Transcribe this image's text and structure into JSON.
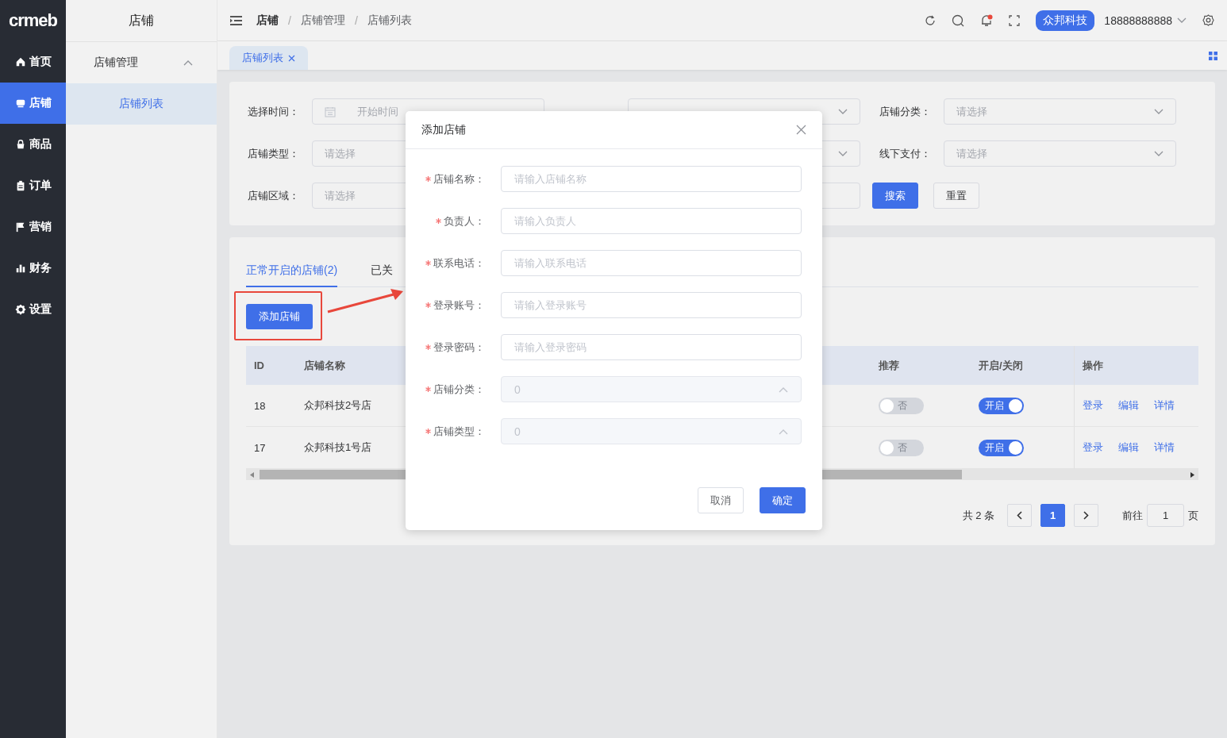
{
  "sidebar": {
    "logo": "crmeb",
    "items": [
      {
        "label": "首页",
        "selected": false
      },
      {
        "label": "店铺",
        "selected": true
      },
      {
        "label": "商品",
        "selected": false
      },
      {
        "label": "订单",
        "selected": false
      },
      {
        "label": "营销",
        "selected": false
      },
      {
        "label": "财务",
        "selected": false
      },
      {
        "label": "设置",
        "selected": false
      }
    ]
  },
  "submenu": {
    "title": "店铺",
    "groups": [
      {
        "label": "店铺管理",
        "expanded": true,
        "children": [
          {
            "label": "店铺列表",
            "selected": true
          }
        ]
      }
    ]
  },
  "header": {
    "breadcrumb": [
      "店铺",
      "店铺管理",
      "店铺列表"
    ],
    "separator": "/",
    "badge": "众邦科技",
    "user": "18888888888"
  },
  "page_tabs": [
    {
      "label": "店铺列表",
      "selected": true
    }
  ],
  "filters": [
    {
      "kind": "daterange",
      "label": "选择时间：",
      "placeholder": "开始时间"
    },
    {
      "kind": "covered-select"
    },
    {
      "kind": "select",
      "label": "店铺分类：",
      "placeholder": "请选择"
    },
    {
      "kind": "select-plain",
      "label": "店铺类型：",
      "placeholder": "请选择"
    },
    {
      "kind": "covered-select"
    },
    {
      "kind": "select",
      "label": "线下支付：",
      "placeholder": "请选择"
    },
    {
      "kind": "select-plain",
      "label": "店铺区域：",
      "placeholder": "请选择"
    },
    {
      "kind": "covered-input"
    },
    {
      "kind": "buttons"
    }
  ],
  "filter_buttons": [
    {
      "label": "搜索",
      "primary": true
    },
    {
      "label": "重置",
      "primary": false
    }
  ],
  "list_tabs": [
    {
      "label": "正常开启的店铺(2)",
      "selected": true
    },
    {
      "label": "已关",
      "selected": false
    }
  ],
  "add_button": "添加店铺",
  "table": {
    "columns": [
      "ID",
      "店铺名称",
      "推荐",
      "开启/关闭",
      "操作"
    ],
    "rows": [
      {
        "id": "18",
        "name": "众邦科技2号店",
        "recommend": {
          "on": false,
          "label": "否"
        },
        "status": {
          "on": true,
          "label": "开启"
        },
        "actions": [
          "登录",
          "编辑",
          "详情"
        ]
      },
      {
        "id": "17",
        "name": "众邦科技1号店",
        "recommend": {
          "on": false,
          "label": "否"
        },
        "status": {
          "on": true,
          "label": "开启"
        },
        "actions": [
          "登录",
          "编辑",
          "详情"
        ]
      }
    ]
  },
  "pagination": {
    "total": "共 2 条",
    "pages": [
      {
        "label": "1",
        "selected": true
      }
    ],
    "goto_label": "前往",
    "goto_value": "1",
    "page_label": "页"
  },
  "dialog": {
    "title": "添加店铺",
    "fields": [
      {
        "kind": "input",
        "label": "店铺名称：",
        "required": true,
        "placeholder": "请输入店铺名称"
      },
      {
        "kind": "input",
        "label": "负责人：",
        "required": true,
        "placeholder": "请输入负责人"
      },
      {
        "kind": "input",
        "label": "联系电话：",
        "required": true,
        "placeholder": "请输入联系电话"
      },
      {
        "kind": "input",
        "label": "登录账号：",
        "required": true,
        "placeholder": "请输入登录账号"
      },
      {
        "kind": "input",
        "label": "登录密码：",
        "required": true,
        "placeholder": "请输入登录密码"
      },
      {
        "kind": "select",
        "label": "店铺分类：",
        "required": true,
        "value": "0",
        "disabled": true
      },
      {
        "kind": "select",
        "label": "店铺类型：",
        "required": true,
        "value": "0",
        "disabled": true
      }
    ],
    "buttons": [
      {
        "label": "取消",
        "primary": false
      },
      {
        "label": "确定",
        "primary": true
      }
    ]
  }
}
